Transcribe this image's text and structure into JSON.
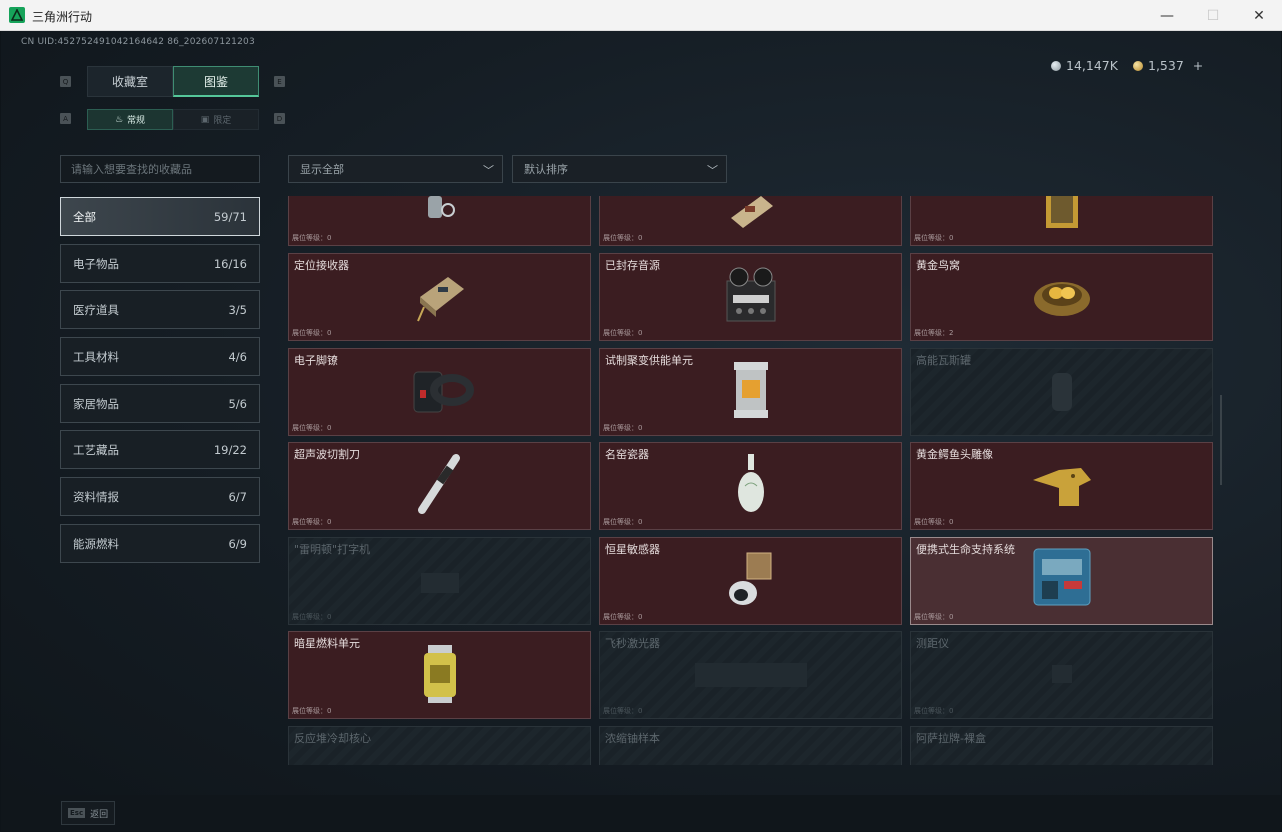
{
  "window": {
    "title": "三角洲行动",
    "min": "—",
    "max": "☐",
    "close": "✕"
  },
  "uid": "CN UID:452752491042164642 86_202607121203",
  "currency": {
    "silver": "14,147K",
    "gold": "1,537",
    "plus": "+"
  },
  "tabs": {
    "collection": "收藏室",
    "gallery": "图鉴",
    "key_left": "Q",
    "key_right": "E"
  },
  "subtabs": {
    "normal": "常规",
    "limited": "限定",
    "key_left": "A",
    "key_right": "D"
  },
  "search": {
    "placeholder": "请输入想要查找的收藏品"
  },
  "filters": {
    "show": "显示全部",
    "sort": "默认排序"
  },
  "categories": [
    {
      "label": "全部",
      "count": "59/71"
    },
    {
      "label": "电子物品",
      "count": "16/16"
    },
    {
      "label": "医疗道具",
      "count": "3/5"
    },
    {
      "label": "工具材料",
      "count": "4/6"
    },
    {
      "label": "家居物品",
      "count": "5/6"
    },
    {
      "label": "工艺藏品",
      "count": "19/22"
    },
    {
      "label": "资料情报",
      "count": "6/7"
    },
    {
      "label": "能源燃料",
      "count": "6/9"
    }
  ],
  "items": [
    {
      "name": "",
      "level": "展位等级：0"
    },
    {
      "name": "",
      "level": "展位等级：0"
    },
    {
      "name": "",
      "level": "展位等级：0"
    },
    {
      "name": "定位接收器",
      "level": "展位等级：0"
    },
    {
      "name": "已封存音源",
      "level": "展位等级：0"
    },
    {
      "name": "黄金鸟窝",
      "level": "展位等级：2"
    },
    {
      "name": "电子脚镣",
      "level": "展位等级：0"
    },
    {
      "name": "试制聚变供能单元",
      "level": "展位等级：0"
    },
    {
      "name": "高能瓦斯罐",
      "level": ""
    },
    {
      "name": "超声波切割刀",
      "level": "展位等级：0"
    },
    {
      "name": "名窑瓷器",
      "level": "展位等级：0"
    },
    {
      "name": "黄金鳄鱼头雕像",
      "level": "展位等级：0"
    },
    {
      "name": "\"雷明顿\"打字机",
      "level": "展位等级：0"
    },
    {
      "name": "恒星敏感器",
      "level": "展位等级：0"
    },
    {
      "name": "便携式生命支持系统",
      "level": "展位等级：0"
    },
    {
      "name": "暗星燃料单元",
      "level": "展位等级：0"
    },
    {
      "name": "飞秒激光器",
      "level": "展位等级：0"
    },
    {
      "name": "测距仪",
      "level": "展位等级：0"
    },
    {
      "name": "反应堆冷却核心",
      "level": ""
    },
    {
      "name": "浓缩铀样本",
      "level": ""
    },
    {
      "name": "阿萨拉牌-裸盒",
      "level": ""
    }
  ],
  "footer": {
    "esc_key": "Esc",
    "back": "返回"
  }
}
